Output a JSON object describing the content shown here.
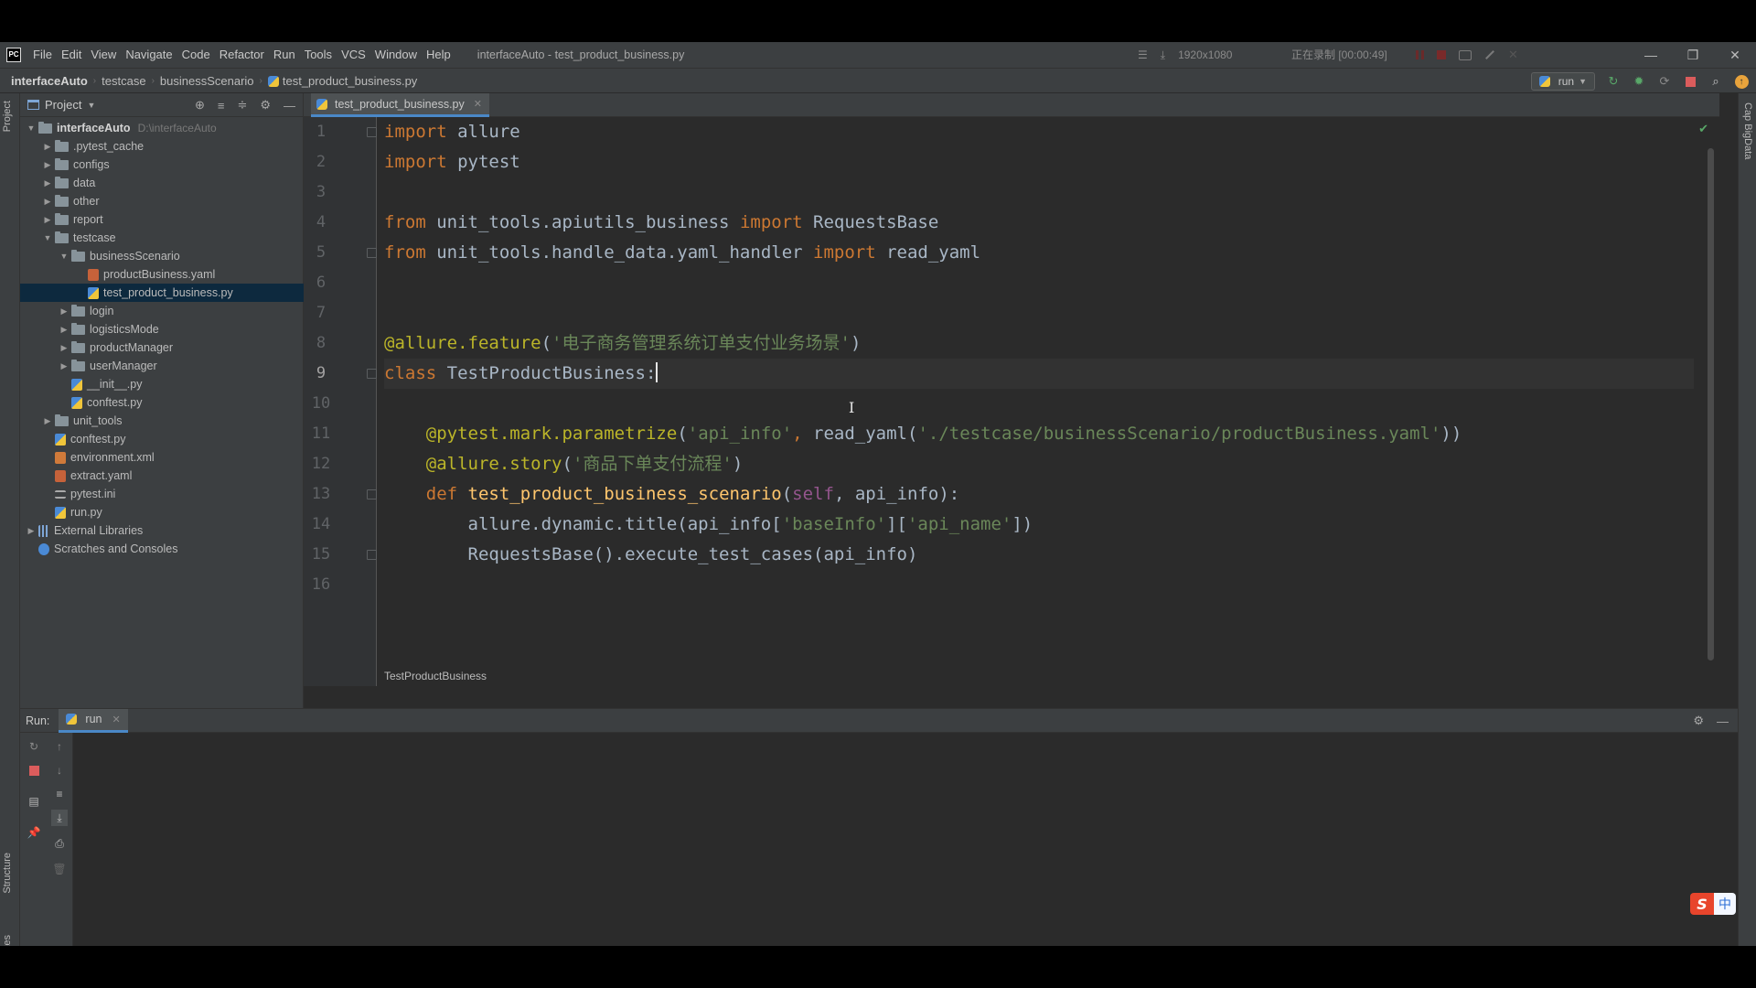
{
  "menubar": {
    "items": [
      "File",
      "Edit",
      "View",
      "Navigate",
      "Code",
      "Refactor",
      "Run",
      "Tools",
      "VCS",
      "Window",
      "Help"
    ],
    "window_title": "interfaceAuto - test_product_business.py",
    "recorder_resolution": "1920x1080",
    "recorder_status": "正在录制 [00:00:49]"
  },
  "navbar": {
    "crumbs": [
      "interfaceAuto",
      "testcase",
      "businessScenario",
      "test_product_business.py"
    ],
    "run_config": "run"
  },
  "left_strip": {
    "project_tab": "Project",
    "structure_tab": "Structure",
    "favorites_tab": "Favorites"
  },
  "right_strip": {
    "tab": "Cap BigData"
  },
  "project_panel": {
    "title": "Project",
    "tree": [
      {
        "label": "interfaceAuto",
        "path": "D:\\interfaceAuto"
      },
      {
        "label": ".pytest_cache"
      },
      {
        "label": "configs"
      },
      {
        "label": "data"
      },
      {
        "label": "other"
      },
      {
        "label": "report"
      },
      {
        "label": "testcase"
      },
      {
        "label": "businessScenario"
      },
      {
        "label": "productBusiness.yaml"
      },
      {
        "label": "test_product_business.py"
      },
      {
        "label": "login"
      },
      {
        "label": "logisticsMode"
      },
      {
        "label": "productManager"
      },
      {
        "label": "userManager"
      },
      {
        "label": "__init__.py"
      },
      {
        "label": "conftest.py"
      },
      {
        "label": "unit_tools"
      },
      {
        "label": "conftest.py"
      },
      {
        "label": "environment.xml"
      },
      {
        "label": "extract.yaml"
      },
      {
        "label": "pytest.ini"
      },
      {
        "label": "run.py"
      },
      {
        "label": "External Libraries"
      },
      {
        "label": "Scratches and Consoles"
      }
    ]
  },
  "editor": {
    "tab": "test_product_business.py",
    "line_numbers": [
      "1",
      "2",
      "3",
      "4",
      "5",
      "6",
      "7",
      "8",
      "9",
      "10",
      "11",
      "12",
      "13",
      "14",
      "15",
      "16"
    ],
    "current_line": "9",
    "code": {
      "l1_kw": "import",
      "l1_rest": " allure",
      "l2_kw": "import",
      "l2_rest": " pytest",
      "l4_kw1": "from",
      "l4_mid": " unit_tools.apiutils_business ",
      "l4_kw2": "import",
      "l4_rest": " RequestsBase",
      "l5_kw1": "from",
      "l5_mid": " unit_tools.handle_data.yaml_handler ",
      "l5_kw2": "import",
      "l5_rest": " read_yaml",
      "l8_deco": "@allure.feature",
      "l8_open": "(",
      "l8_str": "'电子商务管理系统订单支付业务场景'",
      "l8_close": ")",
      "l9_kw": "class",
      "l9_rest": " TestProductBusiness:",
      "l11_deco": "@pytest.mark.parametrize",
      "l11_open": "(",
      "l11_str1": "'api_info'",
      "l11_comma": ", ",
      "l11_mid": "read_yaml(",
      "l11_str2": "'./testcase/businessScenario/productBusiness.yaml'",
      "l11_close": "))",
      "l12_deco": "@allure.story",
      "l12_open": "(",
      "l12_str": "'商品下单支付流程'",
      "l12_close": ")",
      "l13_kw": "def",
      "l13_fn": "test_product_business_scenario",
      "l13_open": "(",
      "l13_self": "self",
      "l13_rest": ", api_info):",
      "l14_a": "allure.dynamic.title(api_info[",
      "l14_s1": "'baseInfo'",
      "l14_b": "][",
      "l14_s2": "'api_name'",
      "l14_c": "])",
      "l15": "RequestsBase().execute_test_cases(api_info)"
    },
    "breadcrumb": "TestProductBusiness"
  },
  "run_panel": {
    "label": "Run:",
    "tab": "run"
  },
  "ime": {
    "lang": "中",
    "brand": "S"
  },
  "colors": {
    "background": "#2b2b2b",
    "panel": "#3c3f41",
    "keyword": "#cc7832",
    "string": "#6a8759",
    "decorator": "#bbb529",
    "selection": "#0d293e",
    "accent": "#4a88c7"
  }
}
